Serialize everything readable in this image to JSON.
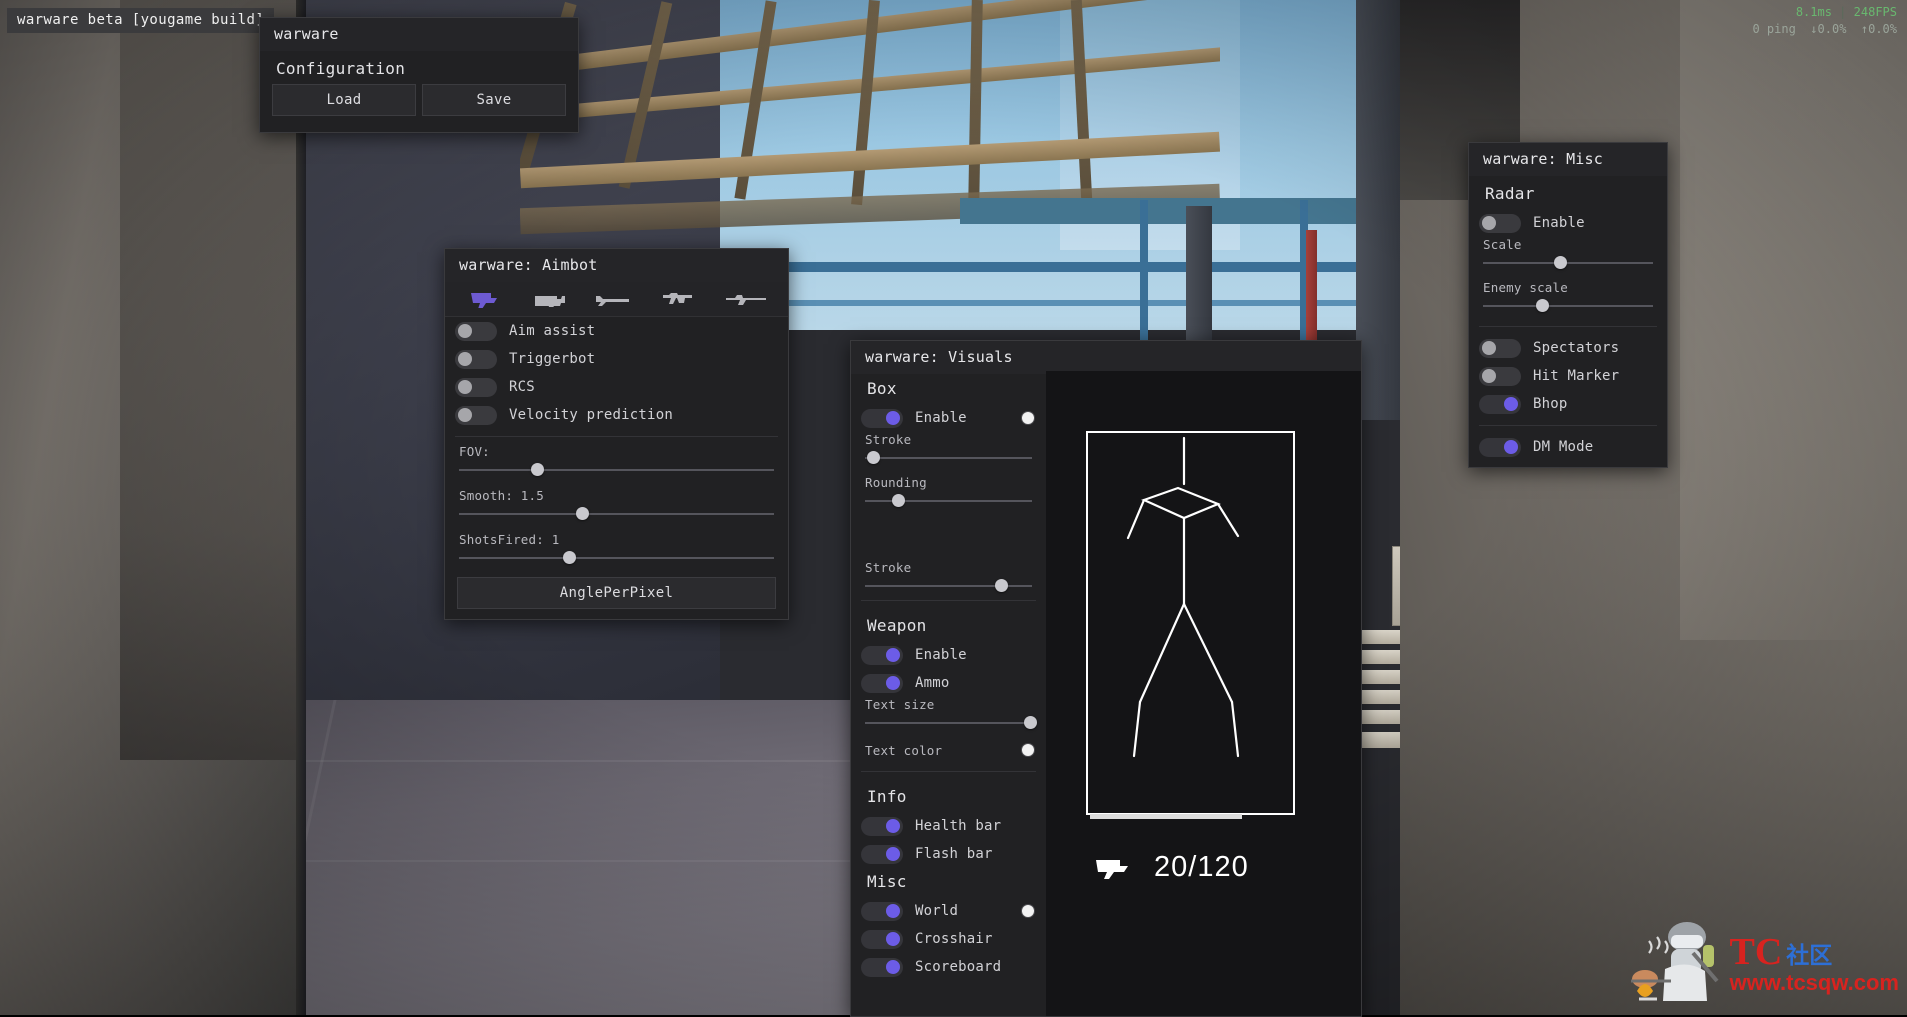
{
  "watermark_tag": "warware beta [yougame build]",
  "hud": {
    "frametime": "8.1ms",
    "separator": "|",
    "fps": "248FPS",
    "ping": "0 ping",
    "loss_down": "↓0.0%",
    "loss_up": "↑0.0%"
  },
  "config_window": {
    "title": "warware",
    "section": "Configuration",
    "load_label": "Load",
    "save_label": "Save"
  },
  "aimbot_window": {
    "title": "warware: Aimbot",
    "weapon_tabs": [
      {
        "name": "pistol-icon",
        "active": true
      },
      {
        "name": "smg-icon",
        "active": false
      },
      {
        "name": "shotgun-icon",
        "active": false
      },
      {
        "name": "rifle-icon",
        "active": false
      },
      {
        "name": "sniper-icon",
        "active": false
      }
    ],
    "toggles": [
      {
        "label": "Aim assist",
        "on": false
      },
      {
        "label": "Triggerbot",
        "on": false
      },
      {
        "label": "RCS",
        "on": false
      },
      {
        "label": "Velocity prediction",
        "on": false
      }
    ],
    "sliders": [
      {
        "label": "FOV:",
        "pos_pct": 24
      },
      {
        "label": "Smooth: 1.5",
        "pos_pct": 39
      },
      {
        "label": "ShotsFired: 1",
        "pos_pct": 35
      }
    ],
    "button_label": "AnglePerPixel"
  },
  "visuals_window": {
    "title": "warware: Visuals",
    "sections": [
      {
        "heading": "Box",
        "toggles": [
          {
            "label": "Enable",
            "on": true,
            "swatch": "#f2f2f2"
          }
        ],
        "sliders": [
          {
            "label": "Stroke",
            "pos_pct": 2
          },
          {
            "label": "Rounding",
            "pos_pct": 17
          }
        ]
      },
      {
        "heading": "",
        "sliders": [
          {
            "label": "Stroke",
            "pos_pct": 80
          }
        ]
      },
      {
        "heading": "Weapon",
        "toggles": [
          {
            "label": "Enable",
            "on": true
          },
          {
            "label": "Ammo",
            "on": true
          }
        ],
        "sliders": [
          {
            "label": "Text size",
            "pos_pct": 97
          }
        ],
        "color_row": {
          "label": "Text color",
          "swatch": "#f2f2f2"
        }
      },
      {
        "heading": "Info",
        "toggles": [
          {
            "label": "Health bar",
            "on": true
          },
          {
            "label": "Flash bar",
            "on": true
          }
        ]
      },
      {
        "heading": "Misc",
        "toggles": [
          {
            "label": "World",
            "on": true,
            "swatch": "#f2f2f2"
          },
          {
            "label": "Crosshair",
            "on": true
          },
          {
            "label": "Scoreboard",
            "on": true
          }
        ]
      }
    ],
    "preview": {
      "ammo_current": "20",
      "ammo_sep": "/",
      "ammo_reserve": "120",
      "ammo_text": "20/120",
      "weapon_icon": "pistol-icon"
    }
  },
  "misc_window": {
    "title": "warware: Misc",
    "radar_heading": "Radar",
    "radar_enable": {
      "label": "Enable",
      "on": false
    },
    "sliders": [
      {
        "label": "Scale",
        "pos_pct": 43
      },
      {
        "label": "Enemy scale",
        "pos_pct": 32
      }
    ],
    "toggles": [
      {
        "label": "Spectators",
        "on": false
      },
      {
        "label": "Hit Marker",
        "on": false
      },
      {
        "label": "Bhop",
        "on": true
      }
    ],
    "dm_mode": {
      "label": "DM Mode",
      "on": true
    }
  },
  "site_watermark": {
    "tc": "TC",
    "cn": "社区",
    "url": "www.tcsqw.com"
  },
  "colors": {
    "accent_purple": "#6c5ce7",
    "panel_bg": "#212123",
    "panel_title_bg": "#252528",
    "text": "#d8d8da",
    "fps_green": "#69b86f",
    "watermark_red": "#d8231f",
    "watermark_blue": "#2d6fd6"
  }
}
